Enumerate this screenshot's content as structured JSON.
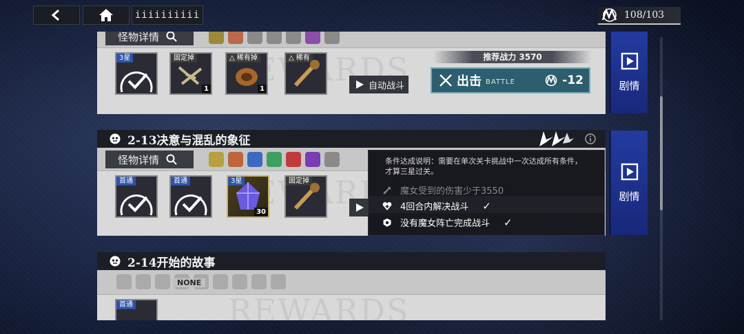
{
  "topbar": {
    "menu_label": "iiiiiiiiii",
    "stamina": "108/103",
    "back_icon": "back-arrow-icon",
    "home_icon": "home-icon"
  },
  "common": {
    "monster_details": "怪物详情",
    "auto_battle": "自动战斗",
    "story": "剧情",
    "rewards_watermark": "REWARDS"
  },
  "stage_prev": {
    "drops": [
      {
        "tag": "3星",
        "count": ""
      },
      {
        "tag": "固定掉",
        "count": "1"
      },
      {
        "tag": "△ 稀有掉",
        "count": "1"
      },
      {
        "tag": "△ 稀有",
        "count": "1"
      }
    ],
    "recommended_power": "推荐战力 3570",
    "sortie_label": "出击",
    "sortie_sub": "BATTLE",
    "cost": "-12"
  },
  "stage_2_13": {
    "title": "2-13决意与混乱的象征",
    "drops": [
      {
        "tag": "首通",
        "count": ""
      },
      {
        "tag": "首通",
        "count": ""
      },
      {
        "tag": "3星",
        "count": "30"
      },
      {
        "tag": "固定掉",
        "count": ""
      }
    ]
  },
  "stage_2_14": {
    "title": "2-14开始的故事",
    "monsters": "NONE",
    "drops": [
      {
        "tag": "首通"
      }
    ]
  },
  "tooltip": {
    "description": "条件达成说明：需要在单次关卡挑战中一次达成所有条件，才算三星过关。",
    "conditions": [
      {
        "text": "魔女受到的伤害少于3550",
        "done": false
      },
      {
        "text": "4回合内解决战斗",
        "done": true
      },
      {
        "text": "没有魔女阵亡完成战斗",
        "done": true
      }
    ]
  },
  "colors": {
    "sortie": "#2c5e6e",
    "story_panel": "#233ba0",
    "first_clear_tag": "#2e53a8"
  }
}
